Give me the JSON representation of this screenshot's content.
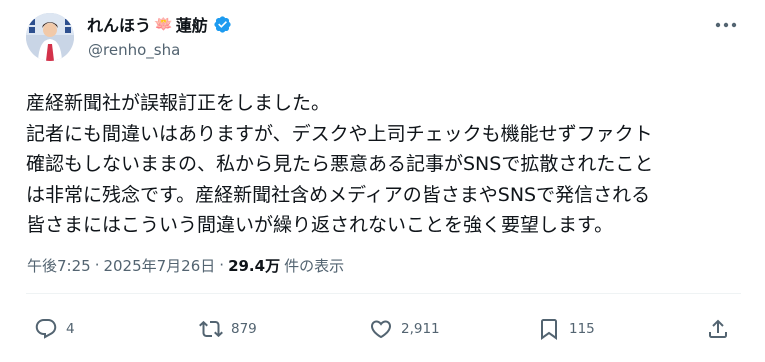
{
  "author": {
    "name_part1": "れんほう",
    "name_emoji": "🪷",
    "name_part2": "蓮舫",
    "handle": "@renho_sha",
    "verified": true
  },
  "post": {
    "lines": [
      "産経新聞社が誤報訂正をしました。",
      "記者にも間違いはありますが、デスクや上司チェックも機能せずファクト",
      "確認もしないままの、私から見たら悪意ある記事がSNSで拡散されたこと",
      "は非常に残念です。産経新聞社含めメディアの皆さまやSNSで発信される",
      "皆さまにはこういう間違いが繰り返されないことを強く要望します。"
    ]
  },
  "meta": {
    "time": "午後7:25",
    "separator1": "·",
    "date": "2025年7月26日",
    "separator2": "·",
    "views": "29.4万",
    "views_label": "件の表示"
  },
  "actions": {
    "replies": "4",
    "reposts": "879",
    "likes": "2,911",
    "bookmarks": "115"
  },
  "colors": {
    "text_primary": "#0f1419",
    "text_secondary": "#536471",
    "verified_blue": "#1d9bf0",
    "divider": "#eff3f4"
  },
  "icons": [
    "more-icon",
    "verified-badge-icon",
    "reply-icon",
    "repost-icon",
    "like-icon",
    "bookmark-icon",
    "share-icon"
  ]
}
